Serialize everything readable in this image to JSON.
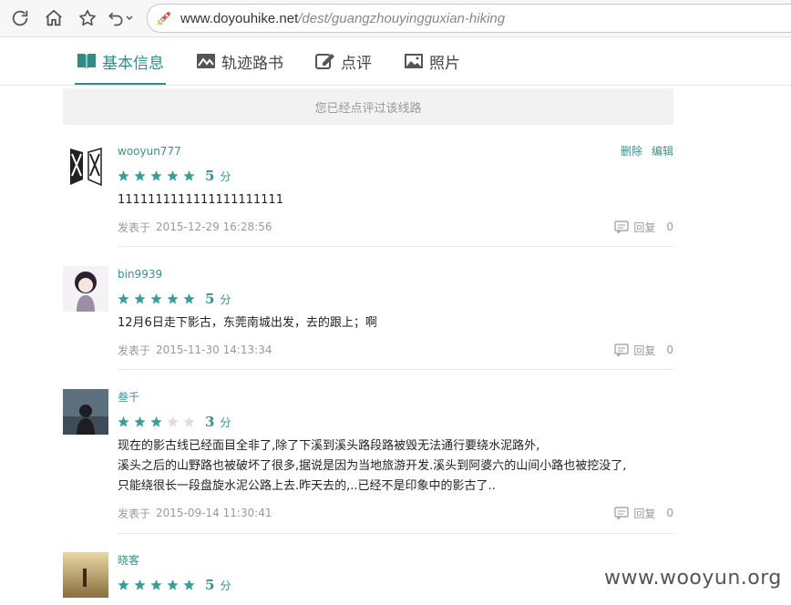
{
  "browser": {
    "url_host": "www.doyouhike.net",
    "url_path": "/dest/guangzhouyingguxian-hiking"
  },
  "tabs": [
    {
      "label": "基本信息",
      "icon": "book-icon",
      "active": true
    },
    {
      "label": "轨迹路书",
      "icon": "chart-icon",
      "active": false
    },
    {
      "label": "点评",
      "icon": "edit-icon",
      "active": false
    },
    {
      "label": "照片",
      "icon": "image-icon",
      "active": false
    }
  ],
  "notice": "您已经点评过该线路",
  "labels": {
    "posted_at": "发表于",
    "reply": "回复",
    "points_unit": "分",
    "delete": "删除",
    "edit": "编辑"
  },
  "comments": [
    {
      "user": "wooyun777",
      "rating": 5,
      "score": "5",
      "content": [
        "1111111111111111111111"
      ],
      "date": "2015-12-29 16:28:56",
      "replies": "0",
      "own": true
    },
    {
      "user": "bin9939",
      "rating": 5,
      "score": "5",
      "content": [
        "12月6日走下影古，东莞南城出发，去的跟上；啊"
      ],
      "date": "2015-11-30 14:13:34",
      "replies": "0"
    },
    {
      "user": "叁千",
      "rating": 3,
      "score": "3",
      "content": [
        "现在的影古线已经面目全非了,除了下溪到溪头路段路被毁无法通行要绕水泥路外,",
        "溪头之后的山野路也被破坏了很多,据说是因为当地旅游开发.溪头到阿婆六的山间小路也被挖没了,",
        "只能绕很长一段盘旋水泥公路上去.昨天去的,..已经不是印象中的影古了.."
      ],
      "date": "2015-09-14 11:30:41",
      "replies": "0"
    },
    {
      "user": "晓客",
      "rating": 5,
      "score": "5",
      "content": [],
      "date": "",
      "replies": ""
    }
  ],
  "watermark": "www.wooyun.org",
  "colors": {
    "accent": "#3a8f8a",
    "star_on": "#3a9e98",
    "star_off": "#dddddd"
  }
}
